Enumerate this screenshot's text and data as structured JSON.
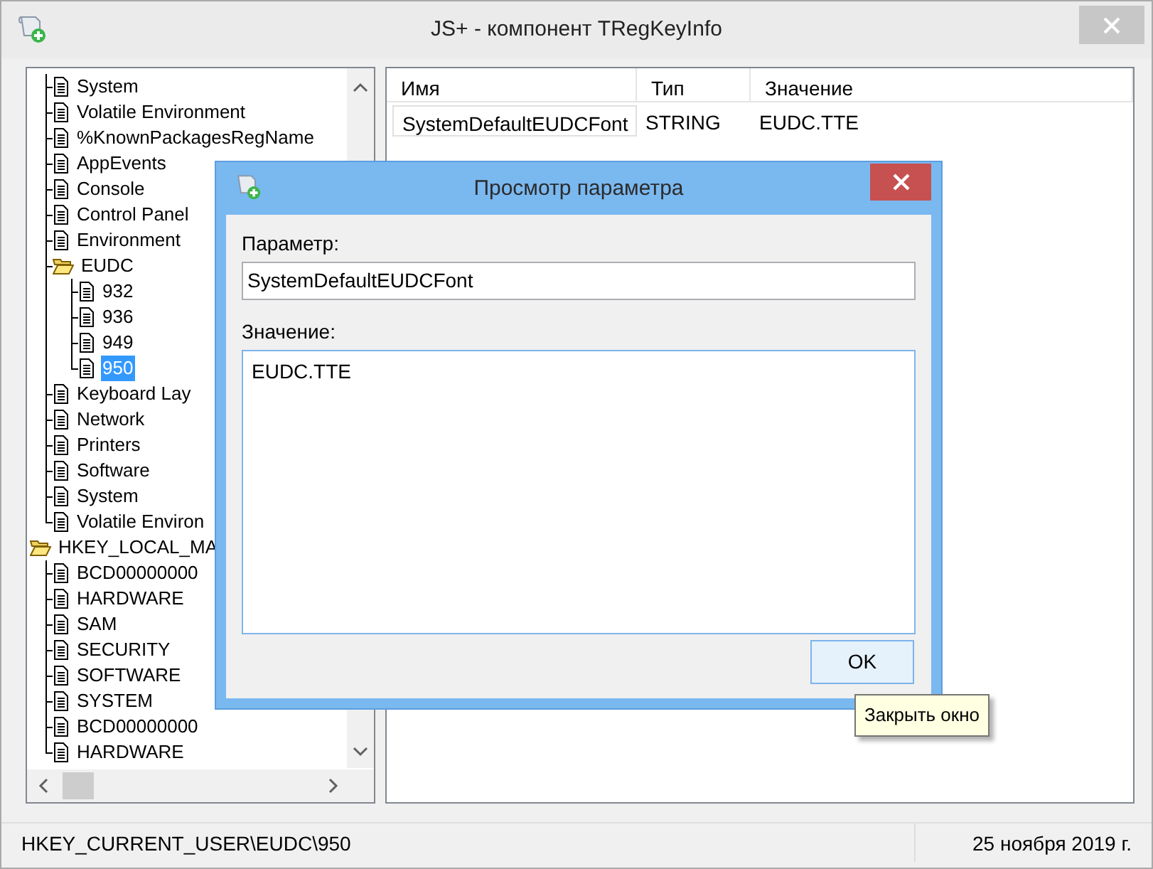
{
  "window": {
    "title": "JS+ - компонент TRegKeyInfo"
  },
  "tree": {
    "scrolled_branch": [
      {
        "label": "System",
        "selected": false
      },
      {
        "label": "Volatile Environment",
        "selected": false
      },
      {
        "label": "%KnownPackagesRegName",
        "selected": false
      },
      {
        "label": "AppEvents",
        "selected": false
      },
      {
        "label": "Console",
        "selected": false
      },
      {
        "label": "Control Panel",
        "selected": false
      },
      {
        "label": "Environment",
        "selected": false
      },
      {
        "label": "EUDC",
        "selected": false,
        "expanded": true,
        "children": [
          {
            "label": "932",
            "selected": false
          },
          {
            "label": "936",
            "selected": false
          },
          {
            "label": "949",
            "selected": false
          },
          {
            "label": "950",
            "selected": true
          }
        ]
      },
      {
        "label": "Keyboard Lay",
        "selected": false
      },
      {
        "label": "Network",
        "selected": false
      },
      {
        "label": "Printers",
        "selected": false
      },
      {
        "label": "Software",
        "selected": false
      },
      {
        "label": "System",
        "selected": false
      },
      {
        "label": "Volatile Environ",
        "selected": false
      }
    ],
    "roots": [
      {
        "label": "HKEY_LOCAL_MA",
        "selected": false,
        "expanded": true,
        "children": [
          {
            "label": "BCD00000000",
            "selected": false
          },
          {
            "label": "HARDWARE",
            "selected": false
          },
          {
            "label": "SAM",
            "selected": false
          },
          {
            "label": "SECURITY",
            "selected": false
          },
          {
            "label": "SOFTWARE",
            "selected": false
          },
          {
            "label": "SYSTEM",
            "selected": false
          },
          {
            "label": "BCD00000000",
            "selected": false
          },
          {
            "label": "HARDWARE",
            "selected": false
          }
        ]
      }
    ]
  },
  "list": {
    "columns": [
      "Имя",
      "Тип",
      "Значение"
    ],
    "rows": [
      {
        "cells": [
          "SystemDefaultEUDCFont",
          "STRING",
          "EUDC.TTE"
        ],
        "focused": true
      }
    ]
  },
  "dialog": {
    "title": "Просмотр параметра",
    "fields": [
      {
        "kind": "line",
        "label": "Параметр:",
        "value": "SystemDefaultEUDCFont"
      },
      {
        "kind": "area",
        "label": "Значение:",
        "value": "EUDC.TTE"
      }
    ],
    "button": "OK"
  },
  "tooltip": "Закрыть окно",
  "status_bar": [
    "HKEY_CURRENT_USER\\EUDC\\950",
    "25 ноября 2019 г."
  ]
}
